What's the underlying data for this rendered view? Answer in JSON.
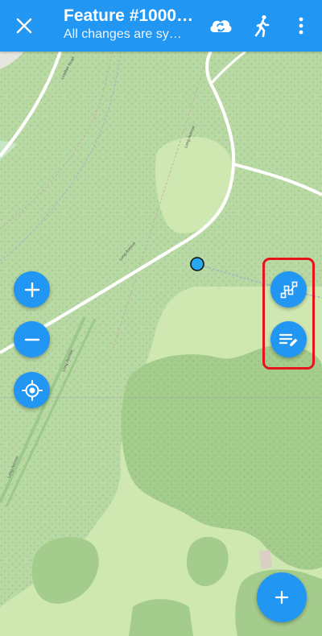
{
  "appbar": {
    "title": "Feature #1000…",
    "subtitle": "All changes are sy…",
    "icons": {
      "close": "close-icon",
      "sync": "cloud-sync-icon",
      "tracking": "walking-icon",
      "overflow": "more-vertical-icon"
    }
  },
  "map": {
    "road_labels": [
      "Lowther Road",
      "Lowther Road",
      "Long Avenue",
      "Long Avenue",
      "Long Avenue",
      "Long Avenue"
    ],
    "colors": {
      "park": "#b9d9a4",
      "wood": "#a4cc8c",
      "meadow": "#cfe8b1",
      "road": "#ffffff"
    }
  },
  "controls": {
    "zoom_in": "plus-icon",
    "zoom_out": "minus-icon",
    "locate": "gps-target-icon",
    "edit_geometry": "edit-geometry-icon",
    "edit_attributes": "edit-attributes-icon",
    "add_feature": "plus-icon"
  },
  "accent_color": "#2196f3",
  "highlight_color": "#e8141c"
}
